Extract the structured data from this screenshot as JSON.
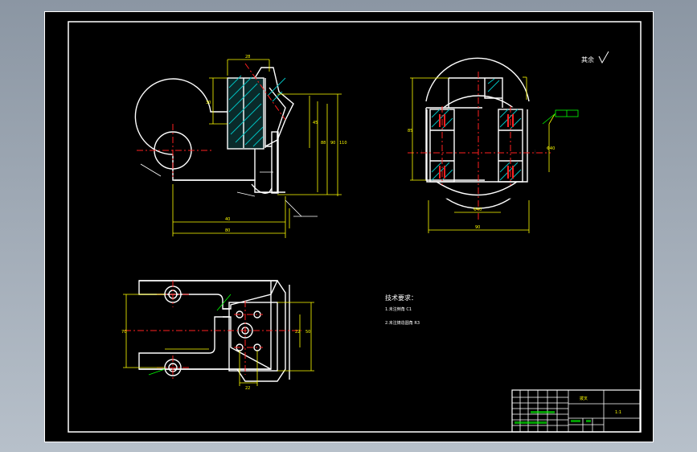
{
  "drawing": {
    "roughness_note": "其余",
    "notes_title": "技术要求：",
    "note_lines": [
      "1.未注倒角 C1",
      "2.未注铸造圆角 R3"
    ],
    "title_block": {
      "drawing_name": "拨叉",
      "scale": "1:1"
    }
  },
  "colors": {
    "background": "#000000",
    "outline": "#ffffff",
    "dimension": "#ffff00",
    "centerline": "#ff2020",
    "leader": "#00ff00",
    "hatch": "#00c0c0"
  }
}
